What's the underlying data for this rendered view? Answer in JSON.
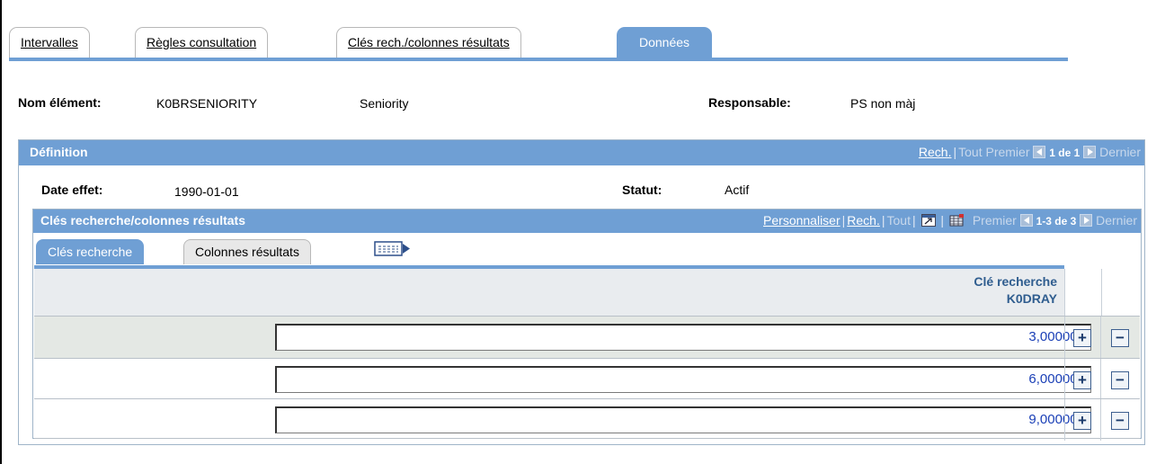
{
  "tabs": [
    {
      "label": "Intervalles"
    },
    {
      "label": "Règles consultation"
    },
    {
      "label": "Clés rech./colonnes résultats"
    },
    {
      "label": "Données",
      "active": true
    }
  ],
  "header": {
    "nom_label": "Nom élément:",
    "nom_code": "K0BRSENIORITY",
    "nom_desc": "Seniority",
    "resp_label": "Responsable:",
    "resp_value": "PS non màj"
  },
  "definition": {
    "title": "Définition",
    "nav": {
      "rech": "Rech.",
      "tout": "Tout",
      "premier": "Premier",
      "count": "1 de 1",
      "dernier": "Dernier"
    },
    "date_label": "Date effet:",
    "date_value": "1990-01-01",
    "statut_label": "Statut:",
    "statut_value": "Actif"
  },
  "grid": {
    "title": "Clés recherche/colonnes résultats",
    "nav": {
      "personnaliser": "Personnaliser",
      "rech": "Rech.",
      "tout": "Tout",
      "premier": "Premier",
      "count": "1-3 de 3",
      "dernier": "Dernier"
    },
    "tabs": [
      {
        "label": "Clés recherche",
        "active": true
      },
      {
        "label": "Colonnes résultats"
      }
    ],
    "column_header_line1": "Clé recherche",
    "column_header_line2": "K0DRAY",
    "rows": [
      {
        "value": "3,000000"
      },
      {
        "value": "6,000000"
      },
      {
        "value": "9,000000"
      }
    ],
    "add_symbol": "+",
    "delete_symbol": "−"
  },
  "colors": {
    "accent": "#6f9fd4",
    "link": "#2f5d8f",
    "value_text": "#1a3fb6"
  }
}
